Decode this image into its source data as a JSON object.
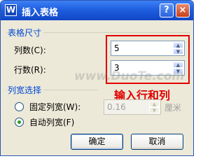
{
  "window": {
    "title": "插入表格",
    "app_icon_letter": "W",
    "help": "?",
    "close": "×"
  },
  "table_size": {
    "legend": "表格尺寸",
    "columns": {
      "label": "列数(C):",
      "value": "5"
    },
    "rows": {
      "label": "行数(R):",
      "value": "3"
    }
  },
  "column_width": {
    "legend": "列宽选择",
    "fixed": {
      "label": "固定列宽(W):",
      "checked": false,
      "value": "0.16",
      "unit": "厘米"
    },
    "auto": {
      "label": "自动列宽(F)",
      "checked": true
    }
  },
  "annotation": "输入行和列",
  "watermark": "www.DuoTe.com",
  "buttons": {
    "ok": "确定",
    "cancel": "取消"
  },
  "colors": {
    "title_bar": "#1f5fe0",
    "group_legend": "#0046d5",
    "annotation": "#e10000"
  }
}
